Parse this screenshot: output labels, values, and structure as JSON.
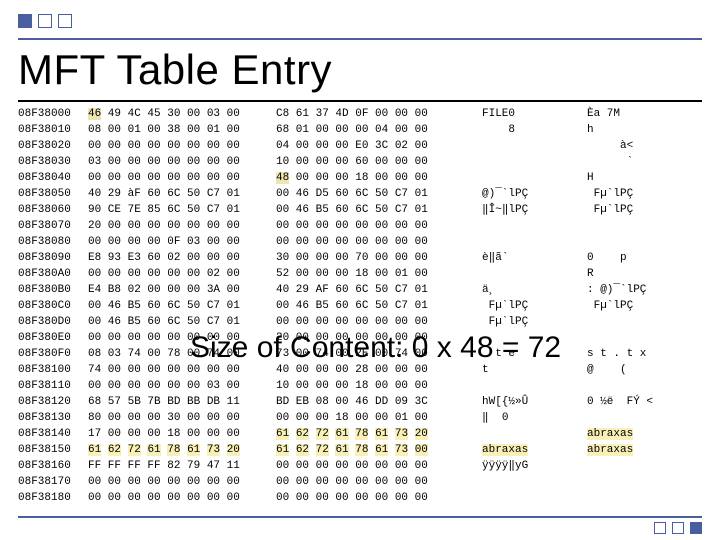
{
  "title": "MFT Table Entry",
  "callout": "Size of Content: 0 x 48 = 72",
  "rows": [
    {
      "off": "08F38000",
      "hexL": [
        "46",
        "49",
        "4C",
        "45",
        "30",
        "00",
        "03",
        "00"
      ],
      "hexR": [
        "C8",
        "61",
        "37",
        "4D",
        "0F",
        "00",
        "00",
        "00"
      ],
      "ascL": "FILE0",
      "ascR": "Èa 7M",
      "hlL": [
        0
      ],
      "hlR": [],
      "revL": [],
      "nameL": [],
      "nameR": []
    },
    {
      "off": "08F38010",
      "hexL": [
        "08",
        "00",
        "01",
        "00",
        "38",
        "00",
        "01",
        "00"
      ],
      "hexR": [
        "68",
        "01",
        "00",
        "00",
        "00",
        "04",
        "00",
        "00"
      ],
      "ascL": "    8",
      "ascR": "h",
      "hlL": [],
      "hlR": [],
      "revL": [],
      "nameL": [],
      "nameR": []
    },
    {
      "off": "08F38020",
      "hexL": [
        "00",
        "00",
        "00",
        "00",
        "00",
        "00",
        "00",
        "00"
      ],
      "hexR": [
        "04",
        "00",
        "00",
        "00",
        "E0",
        "3C",
        "02",
        "00"
      ],
      "ascL": "",
      "ascR": "     à<",
      "hlL": [],
      "hlR": [],
      "revL": [],
      "nameL": [],
      "nameR": []
    },
    {
      "off": "08F38030",
      "hexL": [
        "03",
        "00",
        "00",
        "00",
        "00",
        "00",
        "00",
        "00"
      ],
      "hexR": [
        "10",
        "00",
        "00",
        "00",
        "60",
        "00",
        "00",
        "00"
      ],
      "ascL": "",
      "ascR": "      `",
      "hlL": [],
      "hlR": [],
      "revL": [],
      "nameL": [],
      "nameR": []
    },
    {
      "off": "08F38040",
      "hexL": [
        "00",
        "00",
        "00",
        "00",
        "00",
        "00",
        "00",
        "00"
      ],
      "hexR": [
        "48",
        "00",
        "00",
        "00",
        "18",
        "00",
        "00",
        "00"
      ],
      "ascL": "",
      "ascR": "H",
      "hlL": [],
      "hlR": [
        0
      ],
      "revL": [],
      "nameL": [],
      "nameR": []
    },
    {
      "off": "08F38050",
      "hexL": [
        "40",
        "29",
        "àF",
        "60",
        "6C",
        "50",
        "C7",
        "01"
      ],
      "hexR": [
        "00",
        "46",
        "D5",
        "60",
        "6C",
        "50",
        "C7",
        "01"
      ],
      "ascL": "@)¯`lPÇ",
      "ascR": " Fµ`lPÇ",
      "hlL": [],
      "hlR": [],
      "revL": [],
      "nameL": [],
      "nameR": []
    },
    {
      "off": "08F38060",
      "hexL": [
        "90",
        "CE",
        "7E",
        "85",
        "6C",
        "50",
        "C7",
        "01"
      ],
      "hexR": [
        "00",
        "46",
        "B5",
        "60",
        "6C",
        "50",
        "C7",
        "01"
      ],
      "ascL": "‖Î~‖lPÇ",
      "ascR": " Fµ`lPÇ",
      "hlL": [],
      "hlR": [],
      "revL": [],
      "nameL": [],
      "nameR": []
    },
    {
      "off": "08F38070",
      "hexL": [
        "20",
        "00",
        "00",
        "00",
        "00",
        "00",
        "00",
        "00"
      ],
      "hexR": [
        "00",
        "00",
        "00",
        "00",
        "00",
        "00",
        "00",
        "00"
      ],
      "ascL": "",
      "ascR": "",
      "hlL": [],
      "hlR": [],
      "revL": [],
      "nameL": [],
      "nameR": []
    },
    {
      "off": "08F38080",
      "hexL": [
        "00",
        "00",
        "00",
        "00",
        "0F",
        "03",
        "00",
        "00"
      ],
      "hexR": [
        "00",
        "00",
        "00",
        "00",
        "00",
        "00",
        "00",
        "00"
      ],
      "ascL": "",
      "ascR": "",
      "hlL": [],
      "hlR": [],
      "revL": [],
      "nameL": [],
      "nameR": []
    },
    {
      "off": "08F38090",
      "hexL": [
        "E8",
        "93",
        "E3",
        "60",
        "02",
        "00",
        "00",
        "00"
      ],
      "hexR": [
        "30",
        "00",
        "00",
        "00",
        "70",
        "00",
        "00",
        "00"
      ],
      "ascL": "è‖ã`",
      "ascR": "0    p",
      "hlL": [],
      "hlR": [],
      "revL": [],
      "nameL": [],
      "nameR": []
    },
    {
      "off": "08F380A0",
      "hexL": [
        "00",
        "00",
        "00",
        "00",
        "00",
        "00",
        "02",
        "00"
      ],
      "hexR": [
        "52",
        "00",
        "00",
        "00",
        "18",
        "00",
        "01",
        "00"
      ],
      "ascL": "",
      "ascR": "R",
      "hlL": [],
      "hlR": [],
      "revL": [],
      "nameL": [],
      "nameR": []
    },
    {
      "off": "08F380B0",
      "hexL": [
        "E4",
        "B8",
        "02",
        "00",
        "00",
        "00",
        "3A",
        "00"
      ],
      "hexR": [
        "40",
        "29",
        "AF",
        "60",
        "6C",
        "50",
        "C7",
        "01"
      ],
      "ascL": "ä¸",
      "ascR": ": @)¯`lPÇ",
      "hlL": [],
      "hlR": [],
      "revL": [],
      "nameL": [],
      "nameR": []
    },
    {
      "off": "08F380C0",
      "hexL": [
        "00",
        "46",
        "B5",
        "60",
        "6C",
        "50",
        "C7",
        "01"
      ],
      "hexR": [
        "00",
        "46",
        "B5",
        "60",
        "6C",
        "50",
        "C7",
        "01"
      ],
      "ascL": " Fµ`lPÇ",
      "ascR": " Fµ`lPÇ",
      "hlL": [],
      "hlR": [],
      "revL": [],
      "nameL": [],
      "nameR": []
    },
    {
      "off": "08F380D0",
      "hexL": [
        "00",
        "46",
        "B5",
        "60",
        "6C",
        "50",
        "C7",
        "01"
      ],
      "hexR": [
        "00",
        "00",
        "00",
        "00",
        "00",
        "00",
        "00",
        "00"
      ],
      "ascL": " Fµ`lPÇ",
      "ascR": "",
      "hlL": [],
      "hlR": [],
      "revL": [],
      "nameL": [],
      "nameR": []
    },
    {
      "off": "08F380E0",
      "hexL": [
        "00",
        "00",
        "00",
        "00",
        "00",
        "00",
        "00",
        "00"
      ],
      "hexR": [
        "20",
        "00",
        "00",
        "00",
        "00",
        "00",
        "00",
        "00"
      ],
      "ascL": "",
      "ascR": "",
      "hlL": [],
      "hlR": [],
      "revL": [],
      "nameL": [],
      "nameR": []
    },
    {
      "off": "08F380F0",
      "hexL": [
        "08",
        "03",
        "74",
        "00",
        "78",
        "00",
        "74",
        "00"
      ],
      "hexR": [
        "73",
        "00",
        "74",
        "00",
        "2E",
        "00",
        "74",
        "00"
      ],
      "ascL": "  t e",
      "ascR": "s t . t x",
      "hlL": [],
      "hlR": [],
      "revL": [],
      "nameL": [],
      "nameR": []
    },
    {
      "off": "08F38100",
      "hexL": [
        "74",
        "00",
        "00",
        "00",
        "00",
        "00",
        "00",
        "00"
      ],
      "hexR": [
        "40",
        "00",
        "00",
        "00",
        "28",
        "00",
        "00",
        "00"
      ],
      "ascL": "t",
      "ascR": "@    (",
      "hlL": [],
      "hlR": [],
      "revL": [],
      "nameL": [],
      "nameR": []
    },
    {
      "off": "08F38110",
      "hexL": [
        "00",
        "00",
        "00",
        "00",
        "00",
        "00",
        "03",
        "00"
      ],
      "hexR": [
        "10",
        "00",
        "00",
        "00",
        "18",
        "00",
        "00",
        "00"
      ],
      "ascL": "",
      "ascR": "",
      "hlL": [],
      "hlR": [],
      "revL": [],
      "nameL": [],
      "nameR": []
    },
    {
      "off": "08F38120",
      "hexL": [
        "68",
        "57",
        "5B",
        "7B",
        "BD",
        "BB",
        "DB",
        "11"
      ],
      "hexR": [
        "BD",
        "EB",
        "08",
        "00",
        "46",
        "DD",
        "09",
        "3C"
      ],
      "ascL": "hW[{½»Û",
      "ascR": "0 ½ë  FÝ <",
      "hlL": [],
      "hlR": [],
      "revL": [],
      "nameL": [],
      "nameR": []
    },
    {
      "off": "08F38130",
      "hexL": [
        "80",
        "00",
        "00",
        "00",
        "30",
        "00",
        "00",
        "00"
      ],
      "hexR": [
        "00",
        "00",
        "00",
        "18",
        "00",
        "00",
        "01",
        "00"
      ],
      "ascL": "‖  0",
      "ascR": "",
      "hlL": [],
      "hlR": [],
      "revL": [],
      "nameL": [],
      "nameR": []
    },
    {
      "off": "08F38140",
      "hexL": [
        "17",
        "00",
        "00",
        "00",
        "18",
        "00",
        "00",
        "00"
      ],
      "hexR": [
        "61",
        "62",
        "72",
        "61",
        "78",
        "61",
        "73",
        "20"
      ],
      "ascL": "",
      "ascR": "abraxas",
      "hlL": [],
      "hlR": [],
      "revL": [],
      "nameL": [],
      "nameR": [
        0,
        1,
        2,
        3,
        4,
        5,
        6,
        7
      ]
    },
    {
      "off": "08F38150",
      "hexL": [
        "61",
        "62",
        "72",
        "61",
        "78",
        "61",
        "73",
        "20"
      ],
      "hexR": [
        "61",
        "62",
        "72",
        "61",
        "78",
        "61",
        "73",
        "00"
      ],
      "ascL": "abraxas",
      "ascR": "abraxas",
      "hlL": [],
      "hlR": [],
      "revL": [],
      "nameL": [
        0,
        1,
        2,
        3,
        4,
        5,
        6,
        7
      ],
      "nameR": [
        0,
        1,
        2,
        3,
        4,
        5,
        6,
        7
      ]
    },
    {
      "off": "08F38160",
      "hexL": [
        "FF",
        "FF",
        "FF",
        "FF",
        "82",
        "79",
        "47",
        "11"
      ],
      "hexR": [
        "00",
        "00",
        "00",
        "00",
        "00",
        "00",
        "00",
        "00"
      ],
      "ascL": "ÿÿÿÿ‖yG",
      "ascR": "",
      "hlL": [],
      "hlR": [],
      "revL": [],
      "nameL": [],
      "nameR": []
    },
    {
      "off": "08F38170",
      "hexL": [
        "00",
        "00",
        "00",
        "00",
        "00",
        "00",
        "00",
        "00"
      ],
      "hexR": [
        "00",
        "00",
        "00",
        "00",
        "00",
        "00",
        "00",
        "00"
      ],
      "ascL": "",
      "ascR": "",
      "hlL": [],
      "hlR": [],
      "revL": [],
      "nameL": [],
      "nameR": []
    },
    {
      "off": "08F38180",
      "hexL": [
        "00",
        "00",
        "00",
        "00",
        "00",
        "00",
        "00",
        "00"
      ],
      "hexR": [
        "00",
        "00",
        "00",
        "00",
        "00",
        "00",
        "00",
        "00"
      ],
      "ascL": "",
      "ascR": "",
      "hlL": [],
      "hlR": [],
      "revL": [],
      "nameL": [],
      "nameR": []
    }
  ]
}
